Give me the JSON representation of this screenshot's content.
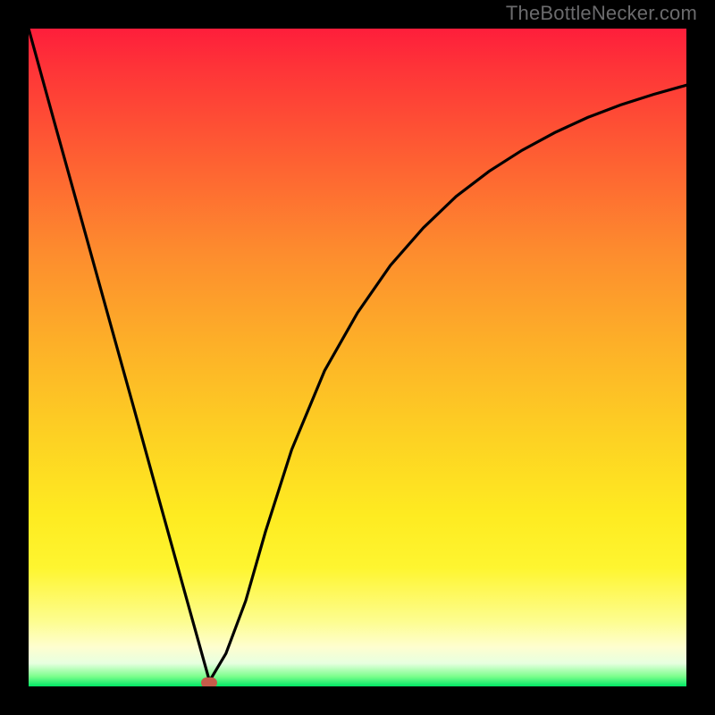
{
  "watermark": "TheBottleNecker.com",
  "chart_data": {
    "type": "line",
    "title": "",
    "xlabel": "",
    "ylabel": "",
    "xlim": [
      0,
      1
    ],
    "ylim": [
      0,
      1
    ],
    "x": [
      0.0,
      0.04,
      0.08,
      0.12,
      0.16,
      0.2,
      0.24,
      0.275,
      0.3,
      0.33,
      0.36,
      0.4,
      0.45,
      0.5,
      0.55,
      0.6,
      0.65,
      0.7,
      0.75,
      0.8,
      0.85,
      0.9,
      0.95,
      1.0
    ],
    "values": [
      1.0,
      0.855,
      0.711,
      0.567,
      0.423,
      0.278,
      0.134,
      0.008,
      0.05,
      0.13,
      0.235,
      0.36,
      0.48,
      0.568,
      0.64,
      0.697,
      0.745,
      0.783,
      0.815,
      0.842,
      0.865,
      0.884,
      0.9,
      0.914
    ],
    "minimum_x": 0.275,
    "gradient_stops": [
      {
        "pos": 0.0,
        "color": "#fe1e3b"
      },
      {
        "pos": 0.5,
        "color": "#fdb028"
      },
      {
        "pos": 0.82,
        "color": "#fef530"
      },
      {
        "pos": 0.94,
        "color": "#fefecf"
      },
      {
        "pos": 1.0,
        "color": "#00e765"
      }
    ]
  },
  "marker": {
    "x_frac": 0.275,
    "y_frac": 0.006
  }
}
